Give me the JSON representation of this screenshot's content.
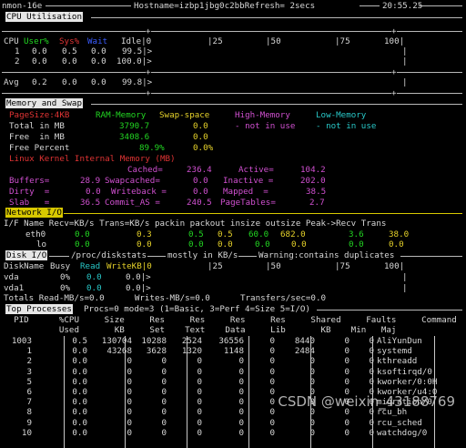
{
  "topbar": {
    "app": "nmon-16e",
    "hostname": "Hostname=izbp1jbg0c2bbRefresh= 2secs",
    "time": "20:55.25"
  },
  "cpu": {
    "title": "CPU Utilisation",
    "scale": [
      "|25",
      "|50",
      "|75",
      "100|"
    ],
    "header": {
      "cpu": "CPU",
      "user": "User%",
      "sys": "Sys%",
      "wait": "Wait",
      "idle": "Idle|0"
    },
    "rows": [
      {
        "id": "1",
        "user": "0.0",
        "sys": "0.5",
        "wait": "0.0",
        "idle": "99.5|>"
      },
      {
        "id": "2",
        "user": "0.0",
        "sys": "0.0",
        "wait": "0.0",
        "idle": "100.0|>"
      }
    ],
    "avg": {
      "id": "Avg",
      "user": "0.2",
      "sys": "0.0",
      "wait": "0.0",
      "idle": "99.8|>"
    }
  },
  "mem": {
    "title": "Memory and Swap",
    "pagesize": "PageSize:4KB",
    "ram": "RAM-Memory",
    "swap": "Swap-space",
    "high": "High-Memory",
    "low": "Low-Memory",
    "total_label": "Total in MB",
    "total_ram": "3790.7",
    "total_swap": "0.0",
    "total_high": "- not in use",
    "total_low": "- not in use",
    "free_label": "Free  in MB",
    "free_ram": "3408.6",
    "free_swap": "0.0",
    "pct_label": "Free Percent",
    "pct_ram": "89.9%",
    "pct_swap": "0.0%",
    "kernel_label": "Linux Kernel Internal Memory (MB)",
    "cached_label": "Cached=",
    "cached": "236.4",
    "active_label": "Active=",
    "active": "104.2",
    "buffers_label": "Buffers=",
    "buffers": "28.9",
    "swapcached_label": "Swapcached=",
    "swapcached": "0.0",
    "inactive_label": "Inactive =",
    "inactive": "202.0",
    "dirty_label": "Dirty  =",
    "dirty": "0.0",
    "writeback_label": "Writeback =",
    "writeback": "0.0",
    "mapped_label": "Mapped  =",
    "mapped": "38.5",
    "slab_label": "Slab   =",
    "slab": "36.5",
    "commit_label": "Commit_AS =",
    "commit": "240.5",
    "pagetables_label": "PageTables=",
    "pagetables": "2.7"
  },
  "net": {
    "title": "Network I/O",
    "header": "I/F Name Recv=KB/s Trans=KB/s packin packout insize outsize Peak->Recv Trans",
    "rows": [
      {
        "name": "eth0",
        "recv": "0.0",
        "trans": "0.3",
        "packin": "0.5",
        "packout": "0.5",
        "insize": "60.0",
        "outsize": "682.0",
        "peakrecv": "3.6",
        "peaktrans": "38.0"
      },
      {
        "name": "lo",
        "recv": "0.0",
        "trans": "0.0",
        "packin": "0.0",
        "packout": "0.0",
        "insize": "0.0",
        "outsize": "0.0",
        "peakrecv": "0.0",
        "peaktrans": "0.0"
      }
    ]
  },
  "disk": {
    "title": "Disk I/O",
    "title_rest": "/proc/diskstats",
    "mostly": "mostly in KB/s",
    "warning": "Warning:contains duplicates",
    "header": {
      "name": "DiskName",
      "busy": "Busy",
      "read": "Read",
      "write": "WriteKB|0",
      "s25": "|25",
      "s50": "|50",
      "s75": "|75",
      "s100": "100|"
    },
    "rows": [
      {
        "name": "vda",
        "busy": "0%",
        "read": "0.0",
        "write": "0.0|>"
      },
      {
        "name": "vda1",
        "busy": "0%",
        "read": "0.0",
        "write": "0.0|>"
      }
    ],
    "totals": "Totals Read-MB/s=0.0      Writes-MB/s=0.0      Transfers/sec=0.0"
  },
  "top": {
    "title": "Top Processes",
    "mode": "Procs=0 mode=3 (1=Basic, 3=Perf 4=Size 5=I/O)",
    "h1": "  PID      %CPU     Size     Res     Res     Res     Res     Shared     Faults     Command",
    "h2": "           Used       KB     Set    Text    Data     Lib       KB    Min   Maj",
    "rows": [
      {
        "pid": "1003",
        "cpu": "0.5",
        "size": "130704",
        "set": "10288",
        "text": "2524",
        "data": "36556",
        "lib": "0",
        "shared": "8440",
        "min": "0",
        "maj": "0",
        "cmd": "AliYunDun"
      },
      {
        "pid": "1",
        "cpu": "0.0",
        "size": "43268",
        "set": "3628",
        "text": "1320",
        "data": "1148",
        "lib": "0",
        "shared": "2484",
        "min": "0",
        "maj": "0",
        "cmd": "systemd"
      },
      {
        "pid": "2",
        "cpu": "0.0",
        "size": "0",
        "set": "0",
        "text": "0",
        "data": "0",
        "lib": "0",
        "shared": "0",
        "min": "0",
        "maj": "0",
        "cmd": "kthreadd"
      },
      {
        "pid": "3",
        "cpu": "0.0",
        "size": "0",
        "set": "0",
        "text": "0",
        "data": "0",
        "lib": "0",
        "shared": "0",
        "min": "0",
        "maj": "0",
        "cmd": "ksoftirqd/0"
      },
      {
        "pid": "5",
        "cpu": "0.0",
        "size": "0",
        "set": "0",
        "text": "0",
        "data": "0",
        "lib": "0",
        "shared": "0",
        "min": "0",
        "maj": "0",
        "cmd": "kworker/0:0H"
      },
      {
        "pid": "6",
        "cpu": "0.0",
        "size": "0",
        "set": "0",
        "text": "0",
        "data": "0",
        "lib": "0",
        "shared": "0",
        "min": "0",
        "maj": "0",
        "cmd": "kworker/u4:0"
      },
      {
        "pid": "7",
        "cpu": "0.0",
        "size": "0",
        "set": "0",
        "text": "0",
        "data": "0",
        "lib": "0",
        "shared": "0",
        "min": "0",
        "maj": "0",
        "cmd": "migration/0"
      },
      {
        "pid": "8",
        "cpu": "0.0",
        "size": "0",
        "set": "0",
        "text": "0",
        "data": "0",
        "lib": "0",
        "shared": "0",
        "min": "0",
        "maj": "0",
        "cmd": "rcu_bh"
      },
      {
        "pid": "9",
        "cpu": "0.0",
        "size": "0",
        "set": "0",
        "text": "0",
        "data": "0",
        "lib": "0",
        "shared": "0",
        "min": "0",
        "maj": "0",
        "cmd": "rcu_sched"
      },
      {
        "pid": "10",
        "cpu": "0.0",
        "size": "0",
        "set": "0",
        "text": "0",
        "data": "0",
        "lib": "0",
        "shared": "0",
        "min": "0",
        "maj": "0",
        "cmd": "watchdog/0"
      }
    ]
  },
  "watermark": "CSDN @weixin_43188769"
}
